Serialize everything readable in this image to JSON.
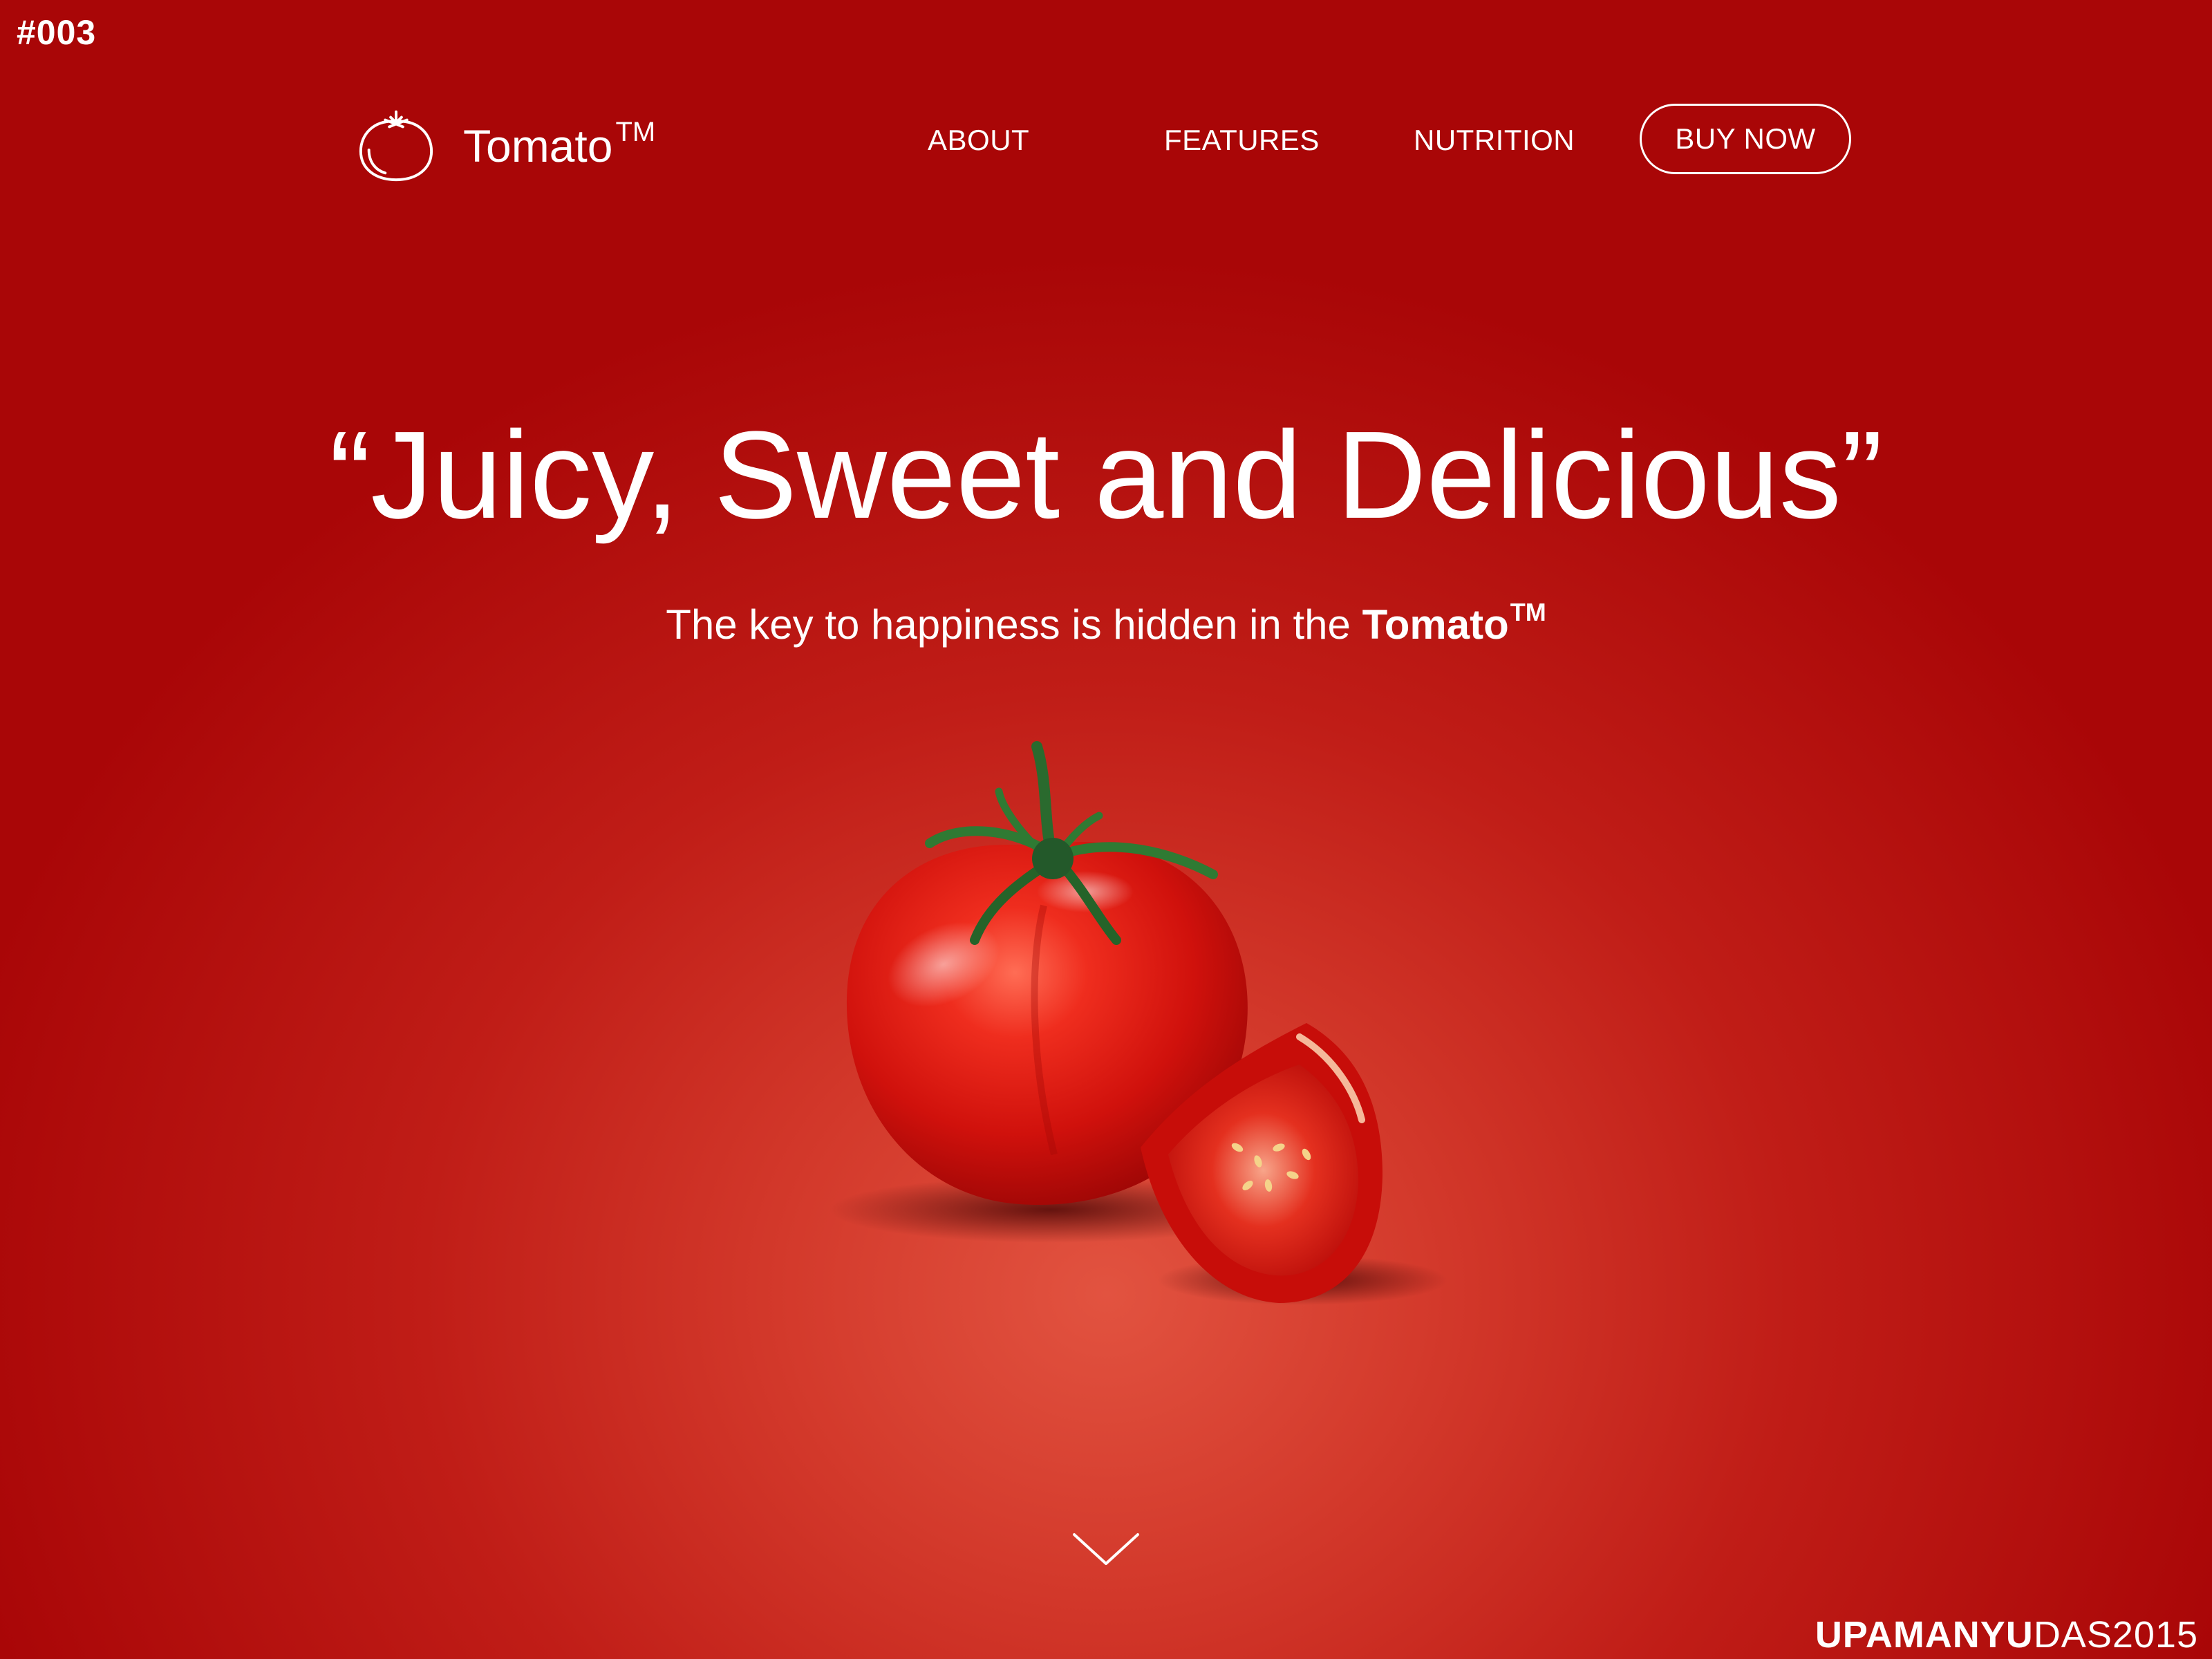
{
  "shot_number": "#003",
  "brand": {
    "name": "Tomato",
    "trademark": "TM"
  },
  "nav": {
    "items": [
      {
        "label": "ABOUT"
      },
      {
        "label": "FEATURES"
      },
      {
        "label": "NUTRITION"
      }
    ],
    "cta_label": "BUY NOW"
  },
  "hero": {
    "headline": "“Juicy, Sweet and Delicious”",
    "subtitle_prefix": "The key to happiness is hidden in the",
    "subtitle_brand": "Tomato",
    "subtitle_trademark": "TM"
  },
  "credit": {
    "first": "UPAMANYU",
    "last": "DAS",
    "year": "2015"
  },
  "colors": {
    "background_outer": "#a90607",
    "background_center": "#e25340",
    "text": "#ffffff",
    "tomato_red": "#d7140f",
    "stem_green": "#2a6a2e"
  },
  "icons": {
    "logo": "tomato-outline-icon",
    "scroll": "chevron-down-icon"
  }
}
